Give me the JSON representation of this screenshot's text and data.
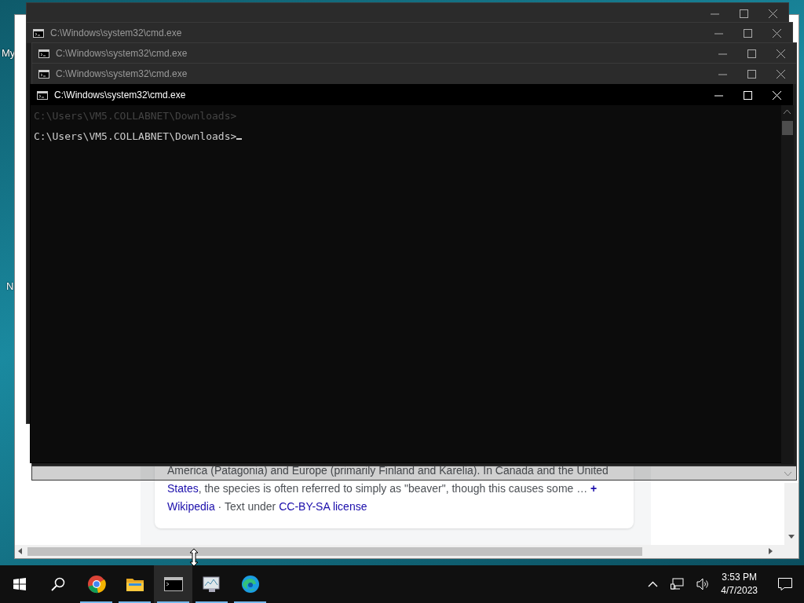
{
  "desktop": {
    "icon_labels": [
      "My",
      "N"
    ]
  },
  "browser": {
    "snippet_lines": [
      {
        "text": "America (Patagonia) and Europe (primarily Finland and Karelia). In Canada and the United"
      },
      {
        "link": "States",
        "text": ", the species is often referred to simply as \"beaver\", though this causes some …",
        "more": "+"
      }
    ],
    "source": {
      "link": "Wikipedia",
      "text": "· Text under",
      "license": "CC-BY-SA license"
    }
  },
  "windows": [
    {
      "selected": false
    },
    {
      "title": "C:\\Windows\\system32\\cmd.exe",
      "selected": false
    },
    {
      "title": "C:\\Windows\\system32\\cmd.exe",
      "selected": false
    },
    {
      "title": "C:\\Windows\\system32\\cmd.exe",
      "selected": false
    },
    {
      "title": "C:\\Windows\\system32\\cmd.exe",
      "selected": true,
      "ghost_line": "C:\\Users\\VM5.COLLABNET\\Downloads>",
      "prompt": "C:\\Users\\VM5.COLLABNET\\Downloads>"
    }
  ],
  "taskbar": {
    "apps": [
      {
        "kind": "browser",
        "running": true,
        "selected": false
      },
      {
        "kind": "folder",
        "running": true,
        "selected": false
      },
      {
        "kind": "console",
        "running": true,
        "selected": true
      },
      {
        "kind": "monitor",
        "running": true,
        "selected": false
      },
      {
        "kind": "edge",
        "running": true,
        "selected": false
      }
    ],
    "time": "3:53 PM",
    "date": "4/7/2023"
  }
}
